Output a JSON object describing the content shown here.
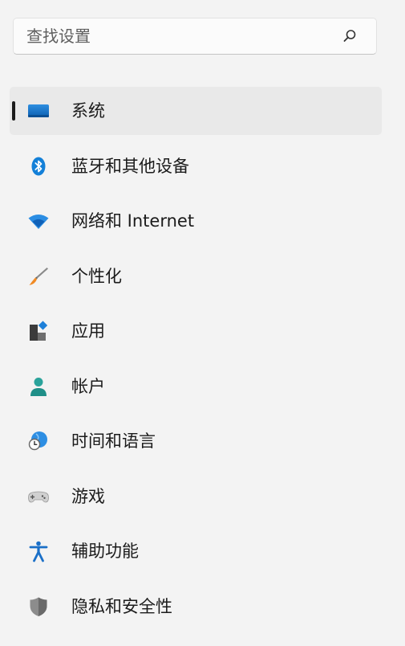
{
  "search": {
    "placeholder": "查找设置"
  },
  "nav": {
    "items": [
      {
        "label": "系统",
        "icon": "system-icon",
        "selected": true
      },
      {
        "label": "蓝牙和其他设备",
        "icon": "bluetooth-icon"
      },
      {
        "label": "网络和 Internet",
        "icon": "wifi-icon"
      },
      {
        "label": "个性化",
        "icon": "brush-icon"
      },
      {
        "label": "应用",
        "icon": "apps-icon"
      },
      {
        "label": "帐户",
        "icon": "account-icon"
      },
      {
        "label": "时间和语言",
        "icon": "time-language-icon"
      },
      {
        "label": "游戏",
        "icon": "gamepad-icon"
      },
      {
        "label": "辅助功能",
        "icon": "accessibility-icon"
      },
      {
        "label": "隐私和安全性",
        "icon": "shield-icon"
      }
    ]
  },
  "colors": {
    "accent": "#0067c0",
    "background": "#f3f3f3",
    "selected_background": "#e9e9e9"
  }
}
